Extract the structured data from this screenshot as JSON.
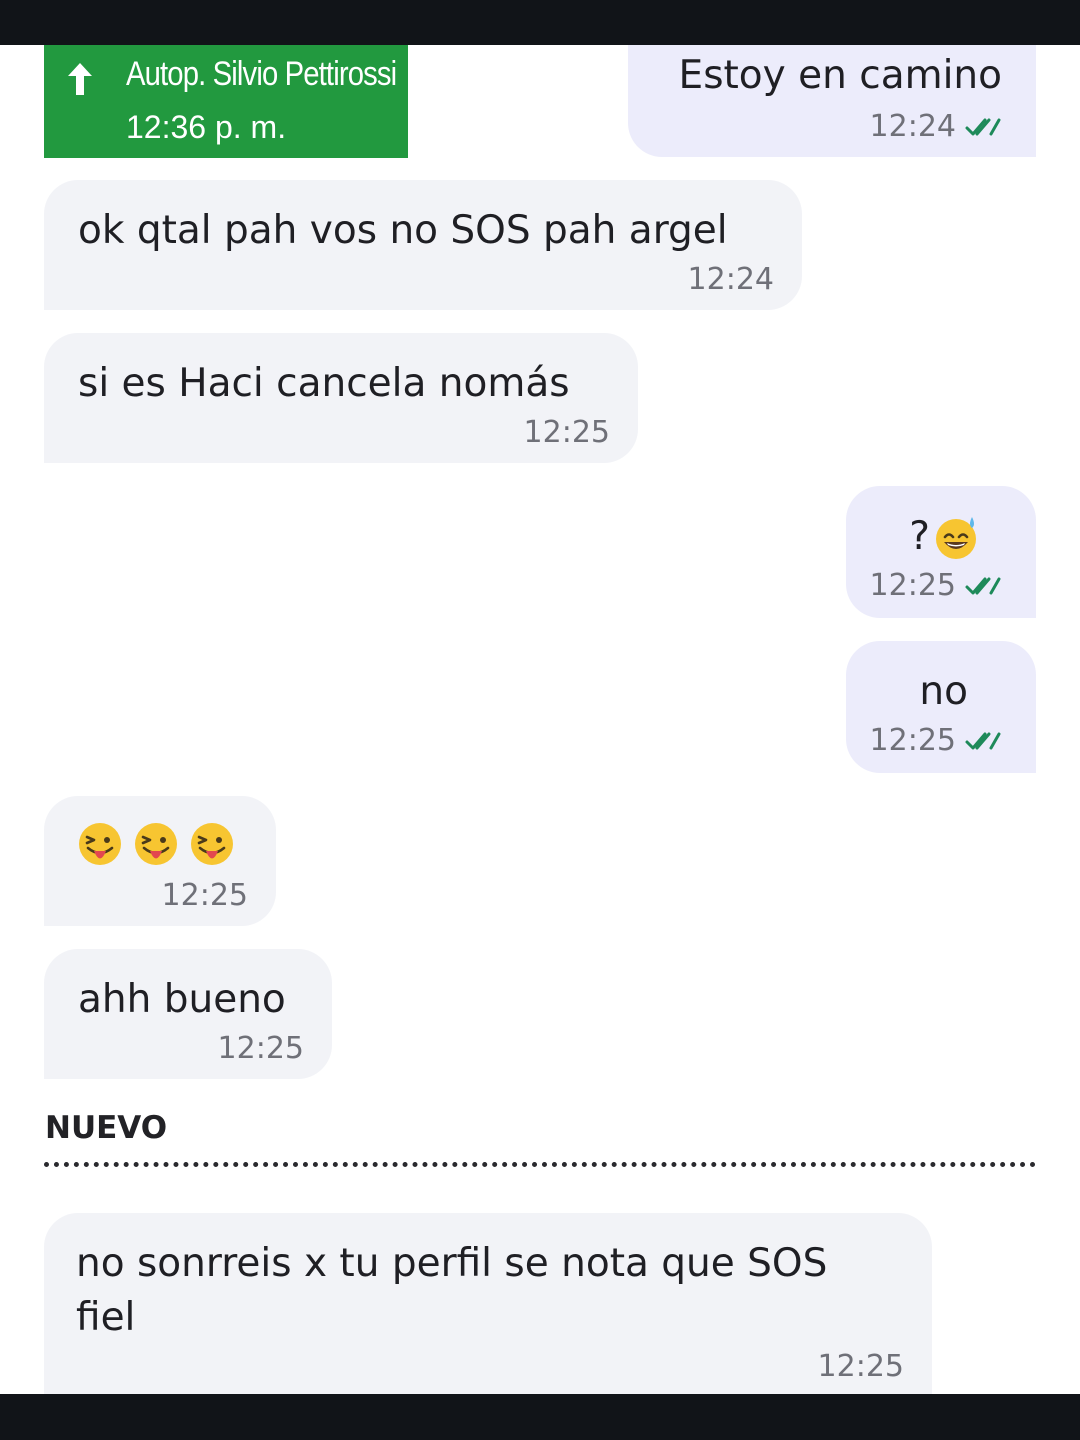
{
  "navigation": {
    "street": "Autop. Silvio Pettirossi",
    "eta": "12:36 p. m.",
    "color": "#22993f",
    "icon": "arrow-up-icon"
  },
  "messages": [
    {
      "direction": "outgoing",
      "text": "Estoy en camino",
      "time": "12:24",
      "status": "read"
    },
    {
      "direction": "incoming",
      "text": "ok qtal pah vos no SOS pah argel",
      "time": "12:24"
    },
    {
      "direction": "incoming",
      "text": "si es Haci cancela nomás",
      "time": "12:25"
    },
    {
      "direction": "outgoing",
      "text": "?",
      "emoji": "sweat-smile-emoji",
      "time": "12:25",
      "status": "read"
    },
    {
      "direction": "outgoing",
      "text": "no",
      "time": "12:25",
      "status": "read"
    },
    {
      "direction": "incoming",
      "emoji": "winking-tongue-emoji",
      "emoji_count": 3,
      "time": "12:25"
    },
    {
      "direction": "incoming",
      "text": "ahh bueno",
      "time": "12:25"
    },
    {
      "direction": "incoming",
      "text_lines": [
        "no sonrreis x tu perfil se nota que SOS",
        "fiel"
      ],
      "time": "12:25"
    }
  ],
  "divider": {
    "label": "NUEVO"
  },
  "colors": {
    "incoming_bubble": "#f2f3f7",
    "outgoing_bubble": "#ececfb",
    "read_ticks": "#1e8a5a"
  }
}
